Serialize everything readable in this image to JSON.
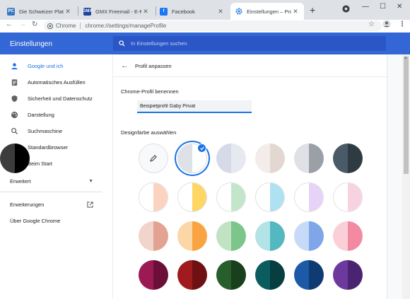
{
  "tabs": [
    {
      "label": "Die Schweizer Plattform",
      "favicon_color": "#3a78c3",
      "favicon_text": "PC",
      "active": false
    },
    {
      "label": "GMX Freemail - E-Mail",
      "favicon_color": "#1c449b",
      "favicon_text": "GMX",
      "active": false
    },
    {
      "label": "Facebook",
      "favicon_color": "#1877f2",
      "favicon_text": "f",
      "active": false
    },
    {
      "label": "Einstellungen – Profil a",
      "favicon_color": "#1a73e8",
      "favicon_text": "",
      "active": true
    }
  ],
  "toolbar": {
    "omnibox_prefix": "Chrome",
    "url": "chrome://settings/manageProfile"
  },
  "header": {
    "title": "Einstellungen",
    "search_placeholder": "In Einstellungen suchen"
  },
  "sidebar": {
    "items": [
      {
        "label": "Google und ich",
        "icon": "person-icon"
      },
      {
        "label": "Automatisches Ausfüllen",
        "icon": "clipboard-icon"
      },
      {
        "label": "Sicherheit und Datenschutz",
        "icon": "shield-icon"
      },
      {
        "label": "Darstellung",
        "icon": "palette-icon"
      },
      {
        "label": "Suchmaschine",
        "icon": "search-icon"
      },
      {
        "label": "Standardbrowser",
        "icon": "browser-icon"
      },
      {
        "label": "Beim Start",
        "icon": "power-icon"
      }
    ],
    "advanced_label": "Erweitert",
    "extensions_label": "Erweiterungen",
    "about_label": "Über Google Chrome"
  },
  "main": {
    "page_title": "Profil anpassen",
    "name_section_label": "Chrome-Profil benennen",
    "profile_name_value": "Beispielprofil Gaby Privat",
    "color_section_label": "Designfarbe auswählen"
  },
  "colors": {
    "accent": "#1a73e8",
    "header": "#3367d6",
    "swatches": [
      [
        "custom",
        [
          "#dee1e6",
          "#ffffff"
        ],
        [
          "#d6dae8",
          "#e6e9ef"
        ],
        [
          "#f3ece8",
          "#e3d7d2"
        ],
        [
          "#dfe1e5",
          "#9aa0a6"
        ],
        [
          "#4a5a66",
          "#2f3b43"
        ],
        [
          "#3c3c3c",
          "#000000"
        ]
      ],
      [
        [
          "#ffffff",
          "#fcd3c1"
        ],
        [
          "#ffffff",
          "#fdd663"
        ],
        [
          "#ffffff",
          "#c3e6cb"
        ],
        [
          "#ffffff",
          "#aee1f2"
        ],
        [
          "#ffffff",
          "#e6d3f7"
        ],
        [
          "#ffffff",
          "#f7d3e1"
        ]
      ],
      [
        [
          "#f1d4cb",
          "#e2a393"
        ],
        [
          "#fcd6a6",
          "#f9a343"
        ],
        [
          "#c1e3c4",
          "#7cc58b"
        ],
        [
          "#b3e3e6",
          "#53b8bf"
        ],
        [
          "#c7daf7",
          "#7ea6e8"
        ],
        [
          "#fbcfd7",
          "#f28ba2"
        ]
      ],
      [
        [
          "#9b1a54",
          "#6b0f39"
        ],
        [
          "#9f1b1d",
          "#6f1112"
        ],
        [
          "#275e2b",
          "#1a3f1c"
        ],
        [
          "#0b5c5e",
          "#073e40"
        ],
        [
          "#1c5aa8",
          "#103b72"
        ],
        [
          "#6c3a9e",
          "#4a2470"
        ]
      ]
    ]
  }
}
